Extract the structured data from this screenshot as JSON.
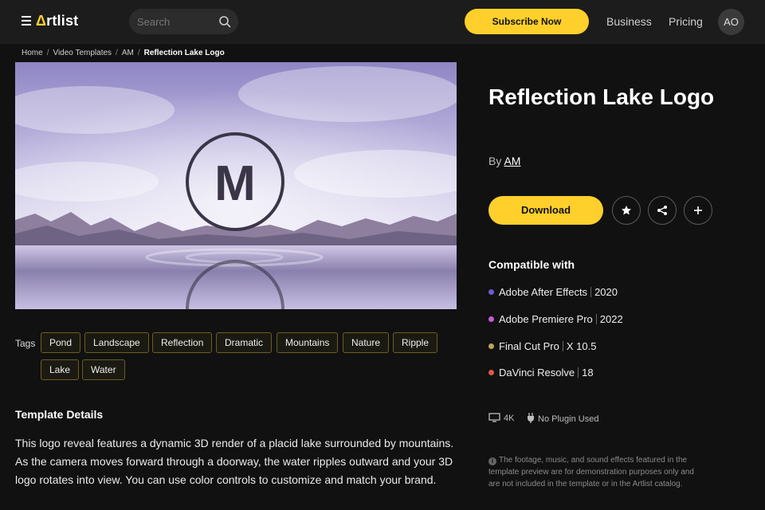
{
  "header": {
    "logo_prefix": "Δ",
    "logo_text": "rtlist",
    "search_placeholder": "Search",
    "subscribe_label": "Subscribe Now",
    "business_label": "Business",
    "pricing_label": "Pricing",
    "avatar_initials": "AO",
    "accent_color": "#ffd02b"
  },
  "breadcrumb": [
    "Home",
    "Video Templates",
    "AM",
    "Reflection Lake Logo"
  ],
  "preview": {
    "logo_letter": "M"
  },
  "tags": {
    "label": "Tags",
    "items": [
      "Pond",
      "Landscape",
      "Reflection",
      "Dramatic",
      "Mountains",
      "Nature",
      "Ripple",
      "Lake",
      "Water"
    ]
  },
  "details": {
    "title": "Template Details",
    "description": "This logo reveal features a dynamic 3D render of a placid lake surrounded by mountains. As the camera moves forward through a doorway, the water ripples outward and your 3D logo rotates into view. You can use color controls to customize and match your brand."
  },
  "product": {
    "title": "Reflection Lake Logo",
    "by_label": "By",
    "author": "AM",
    "download_label": "Download",
    "actions": [
      "star-icon",
      "share-icon",
      "plus-icon"
    ]
  },
  "compatibility": {
    "title": "Compatible with",
    "items": [
      {
        "name": "Adobe After Effects",
        "version": "2020",
        "color": "#6b5bd6"
      },
      {
        "name": "Adobe Premiere Pro",
        "version": "2022",
        "color": "#c85bd6"
      },
      {
        "name": "Final Cut Pro",
        "version": "X 10.5",
        "color": "#b8a657"
      },
      {
        "name": "DaVinci Resolve",
        "version": "18",
        "color": "#e0584a"
      }
    ]
  },
  "specs": {
    "resolution": "4K",
    "plugin": "No Plugin Used"
  },
  "disclaimer": "The footage, music, and sound effects featured in the template preview are for demonstration purposes only and are not included in the template or in the Artlist catalog."
}
